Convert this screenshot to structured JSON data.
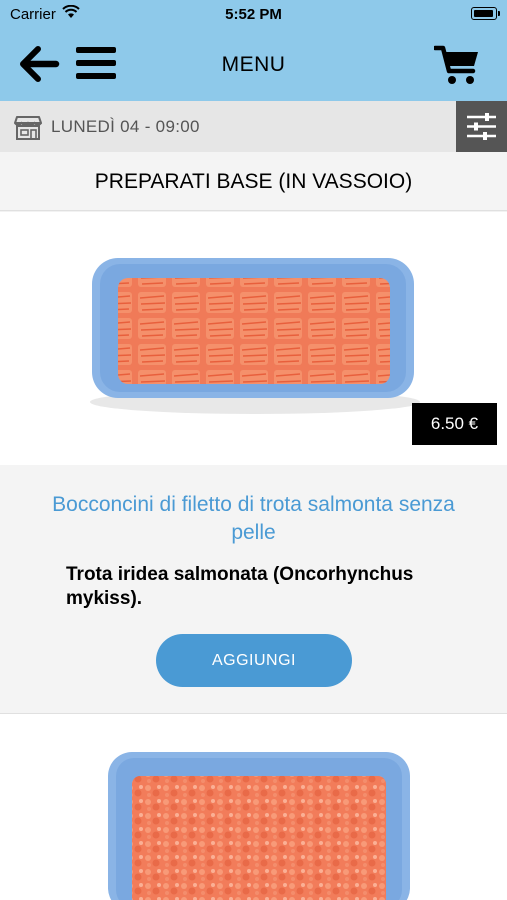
{
  "status": {
    "carrier": "Carrier",
    "time": "5:52 PM"
  },
  "nav": {
    "title": "MENU",
    "icons": [
      "arrow-left-icon",
      "hamburger-icon",
      "cart-icon"
    ]
  },
  "datebar": {
    "text": "LUNEDÌ 04 - 09:00",
    "icons": [
      "shop-icon",
      "filter-sliders-icon"
    ]
  },
  "section": {
    "title": "PREPARATI BASE (IN VASSOIO)"
  },
  "products": [
    {
      "price": "6.50 €",
      "name": "Bocconcini di filetto di trota salmonta senza pelle",
      "description": "Trota iridea salmonata (Oncorhynchus mykiss).",
      "add_label": "AGGIUNGI"
    }
  ],
  "colors": {
    "header": "#8ec9ea",
    "accent": "#4a9ad4",
    "filter_bg": "#555555",
    "date_bar": "#e6e6e6"
  }
}
